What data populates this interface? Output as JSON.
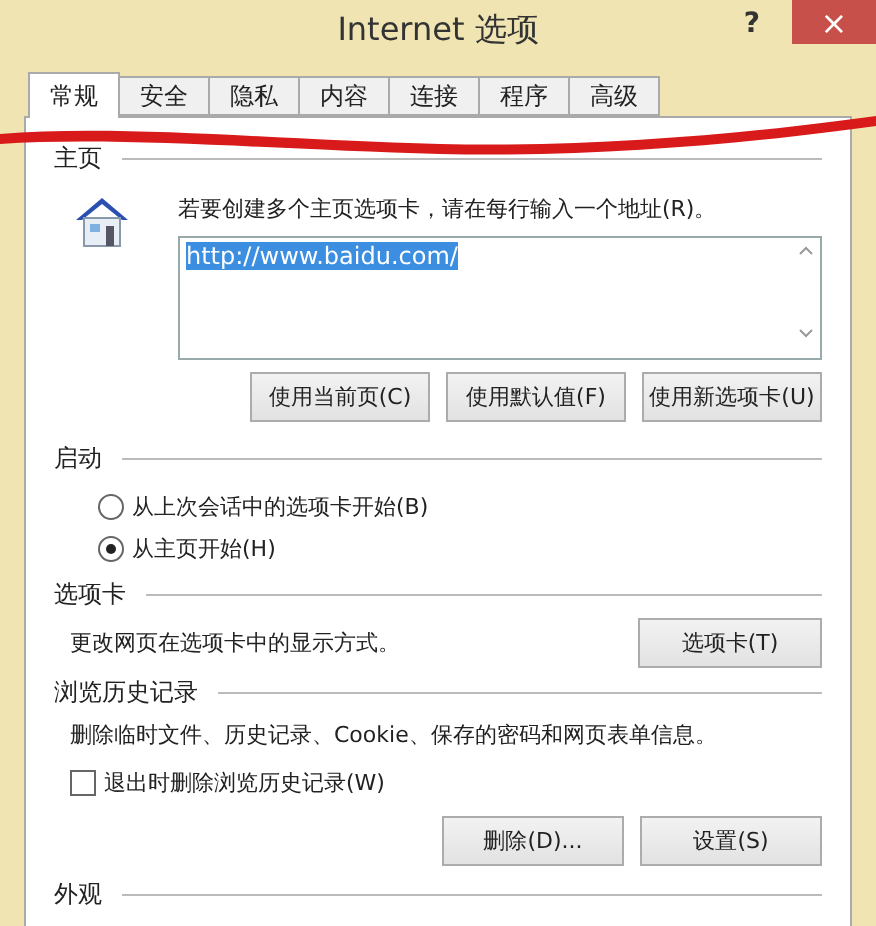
{
  "window": {
    "title": "Internet 选项",
    "help": "?",
    "close": "×"
  },
  "tabs": [
    {
      "label": "常规",
      "selected": true
    },
    {
      "label": "安全",
      "selected": false
    },
    {
      "label": "隐私",
      "selected": false
    },
    {
      "label": "内容",
      "selected": false
    },
    {
      "label": "连接",
      "selected": false
    },
    {
      "label": "程序",
      "selected": false
    },
    {
      "label": "高级",
      "selected": false
    }
  ],
  "home_page": {
    "heading": "主页",
    "instruction": "若要创建多个主页选项卡，请在每行输入一个地址(R)。",
    "value": "http://www.baidu.com/",
    "buttons": [
      "使用当前页(C)",
      "使用默认值(F)",
      "使用新选项卡(U)"
    ]
  },
  "startup": {
    "heading": "启动",
    "options": [
      {
        "label": "从上次会话中的选项卡开始(B)",
        "selected": false
      },
      {
        "label": "从主页开始(H)",
        "selected": true
      }
    ]
  },
  "tabs_section": {
    "heading": "选项卡",
    "description": "更改网页在选项卡中的显示方式。",
    "button": "选项卡(T)"
  },
  "history": {
    "heading": "浏览历史记录",
    "description": "删除临时文件、历史记录、Cookie、保存的密码和网页表单信息。",
    "checkbox": {
      "label": "退出时删除浏览历史记录(W)",
      "checked": false
    },
    "buttons": [
      "删除(D)...",
      "设置(S)"
    ]
  },
  "appearance": {
    "heading": "外观"
  }
}
